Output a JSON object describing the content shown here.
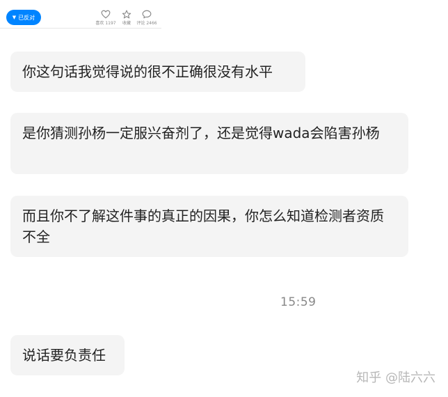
{
  "topbar": {
    "oppose_label": "已反对",
    "stats": [
      {
        "icon": "heart-icon",
        "label": "喜欢 1197"
      },
      {
        "icon": "star-icon",
        "label": "收藏"
      },
      {
        "icon": "comment-icon",
        "label": "评论 2466"
      }
    ]
  },
  "messages": [
    {
      "text": "你这句话我觉得说的很不正确很没有水平"
    },
    {
      "text": "是你猜测孙杨一定服兴奋剂了，还是觉得wada会陷害孙杨"
    },
    {
      "text": "而且你不了解这件事的真正的因果，你怎么知道检测者资质不全"
    },
    {
      "text": "说话要负责任"
    }
  ],
  "timestamp": "15:59",
  "watermark": "知乎 @陆六六",
  "colors": {
    "accent": "#0084ff",
    "bubble": "#f4f4f4",
    "muted": "#888888"
  }
}
